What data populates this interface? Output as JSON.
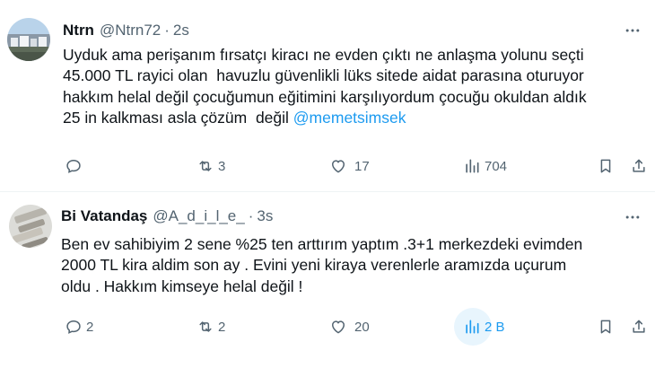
{
  "tweets": [
    {
      "name": "Ntrn",
      "handle": "@Ntrn72",
      "separator": "·",
      "time": "2s",
      "text_before_mention": "Uyduk ama perişanım fırsatçı kiracı ne evden çıktı ne anlaşma yolunu seçti\n45.000 TL rayici olan  havuzlu güvenlikli lüks sitede aidat parasına oturuyor\nhakkım helal değil çocuğumun eğitimini karşılıyordum çocuğu okuldan aldık\n25 in kalkması asla çözüm  değil ",
      "mention": "@memetsimsek",
      "stats": {
        "replies": "",
        "retweets": "3",
        "likes": "17",
        "views": "704"
      },
      "icons": [
        "reply-icon",
        "retweet-icon",
        "like-icon",
        "views-icon",
        "bookmark-icon",
        "share-icon",
        "more-icon"
      ]
    },
    {
      "name": "Bi Vatandaş",
      "handle": "@A_d_i_l_e_",
      "separator": "·",
      "time": "3s",
      "text": "Ben ev sahibiyim 2 sene %25 ten arttırım yaptım .3+1 merkezdeki evimden\n2000 TL kira aldim son ay . Evini yeni kiraya verenlerle aramızda uçurum\noldu . Hakkım kimseye helal değil !",
      "stats": {
        "replies": "2",
        "retweets": "2",
        "likes": "20",
        "views": "2 B"
      },
      "icons": [
        "reply-icon",
        "retweet-icon",
        "like-icon",
        "views-icon",
        "bookmark-icon",
        "share-icon",
        "more-icon"
      ]
    }
  ],
  "colors": {
    "text": "#0f1419",
    "secondary": "#536471",
    "accent": "#1d9bf0",
    "divider": "#eff3f4"
  }
}
